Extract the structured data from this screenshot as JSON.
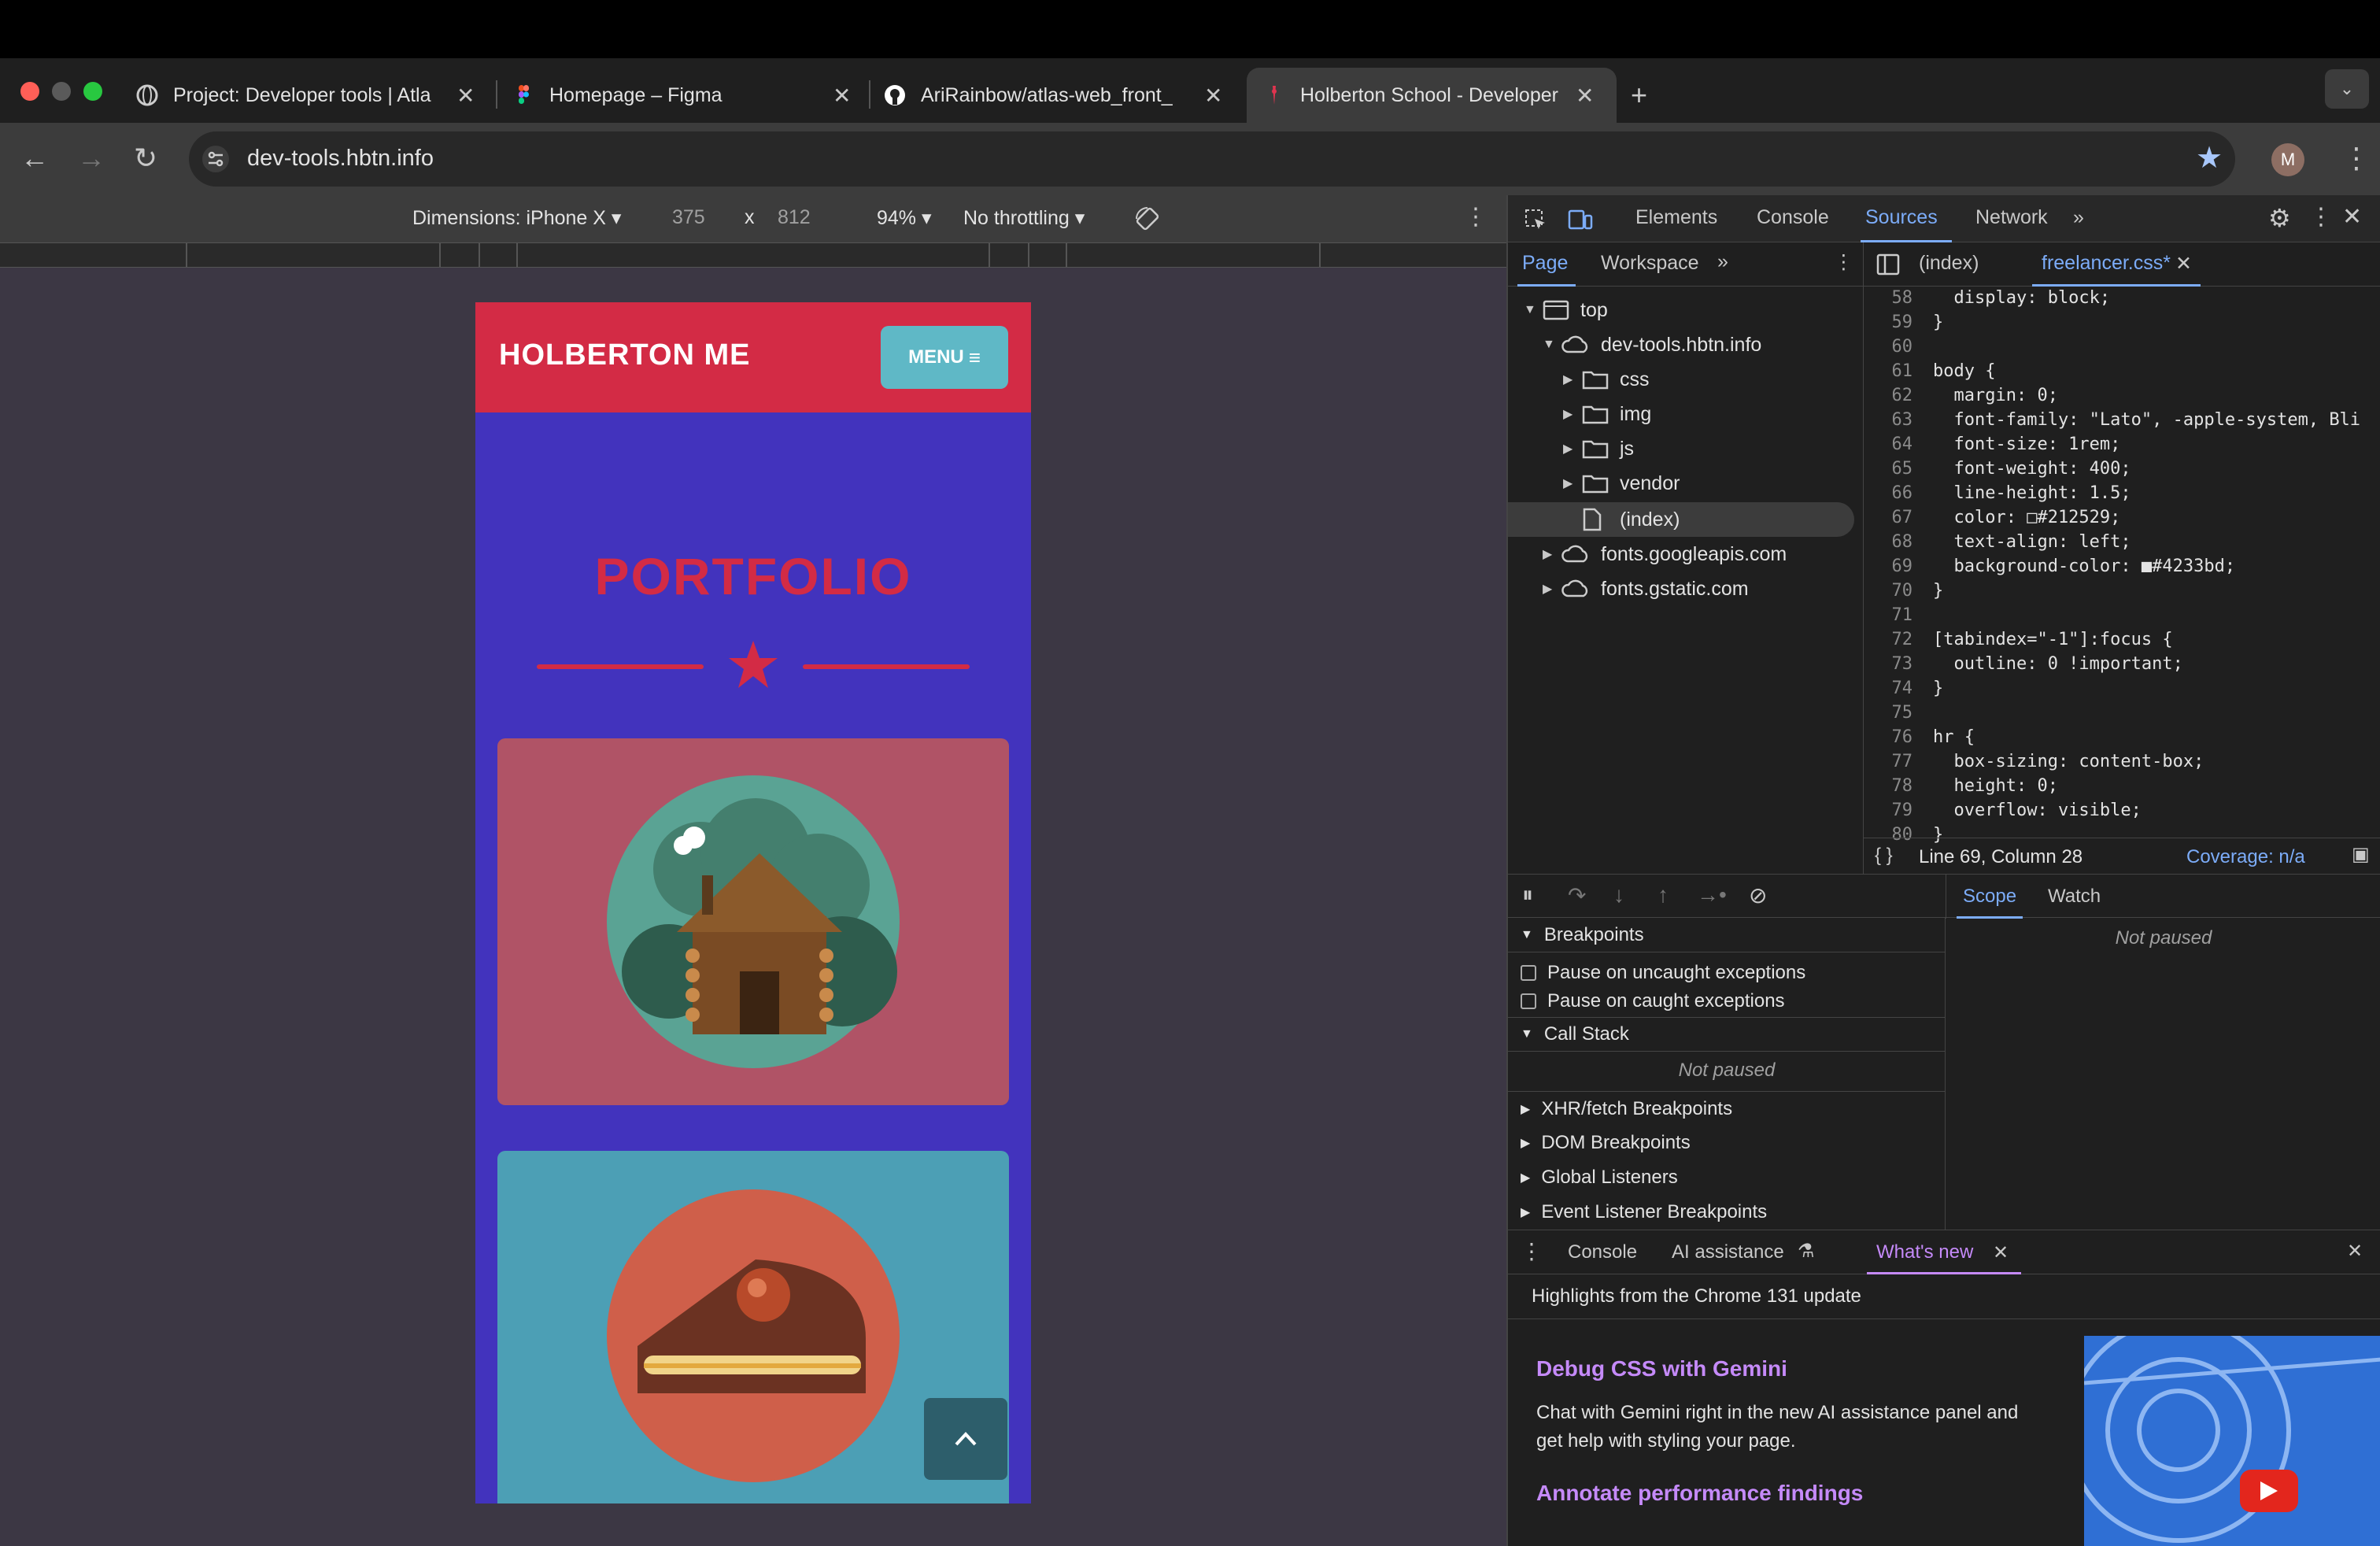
{
  "browser": {
    "tabs": [
      {
        "title": "Project: Developer tools | Atla",
        "icon": "globe-icon"
      },
      {
        "title": "Homepage – Figma",
        "icon": "figma-icon"
      },
      {
        "title": "AriRainbow/atlas-web_front_",
        "icon": "github-icon"
      },
      {
        "title": "Holberton School - Developer",
        "icon": "holberton-icon",
        "active": true
      }
    ],
    "url": "dev-tools.hbtn.info",
    "profile_initial": "M"
  },
  "device_toolbar": {
    "dimensions_label": "Dimensions: iPhone X",
    "width": "375",
    "times": "x",
    "height": "812",
    "zoom": "94%",
    "throttling": "No throttling"
  },
  "mobile_page": {
    "brand": "HOLBERTON ME",
    "menu_label": "MENU",
    "heading": "PORTFOLIO",
    "colors": {
      "nav": "#d32b45",
      "bg": "#4233bd",
      "menu": "#5fb8c6",
      "card1": "#b05366",
      "card2": "#4c9fb5"
    }
  },
  "devtools": {
    "panels": [
      "Elements",
      "Console",
      "Sources",
      "Network"
    ],
    "active_panel": "Sources",
    "navigator": {
      "tabs": [
        "Page",
        "Workspace"
      ],
      "tree": [
        {
          "label": "top",
          "type": "frame"
        },
        {
          "label": "dev-tools.hbtn.info",
          "type": "cloud"
        },
        {
          "label": "css",
          "type": "folder"
        },
        {
          "label": "img",
          "type": "folder"
        },
        {
          "label": "js",
          "type": "folder"
        },
        {
          "label": "vendor",
          "type": "folder"
        },
        {
          "label": "(index)",
          "type": "file"
        },
        {
          "label": "fonts.googleapis.com",
          "type": "cloud"
        },
        {
          "label": "fonts.gstatic.com",
          "type": "cloud"
        }
      ]
    },
    "editor": {
      "tabs": [
        "(index)",
        "freelancer.css*"
      ],
      "lines": [
        {
          "n": "58",
          "text": "  display: block;"
        },
        {
          "n": "59",
          "text": "}"
        },
        {
          "n": "60",
          "text": ""
        },
        {
          "n": "61",
          "text": "body {"
        },
        {
          "n": "62",
          "text": "  margin: 0;"
        },
        {
          "n": "63",
          "text": "  font-family: \"Lato\", -apple-system, Bli"
        },
        {
          "n": "64",
          "text": "  font-size: 1rem;"
        },
        {
          "n": "65",
          "text": "  font-weight: 400;"
        },
        {
          "n": "66",
          "text": "  line-height: 1.5;"
        },
        {
          "n": "67",
          "text": "  color: □#212529;"
        },
        {
          "n": "68",
          "text": "  text-align: left;"
        },
        {
          "n": "69",
          "text": "  background-color: ■#4233bd;"
        },
        {
          "n": "70",
          "text": "}"
        },
        {
          "n": "71",
          "text": ""
        },
        {
          "n": "72",
          "text": "[tabindex=\"-1\"]:focus {"
        },
        {
          "n": "73",
          "text": "  outline: 0 !important;"
        },
        {
          "n": "74",
          "text": "}"
        },
        {
          "n": "75",
          "text": ""
        },
        {
          "n": "76",
          "text": "hr {"
        },
        {
          "n": "77",
          "text": "  box-sizing: content-box;"
        },
        {
          "n": "78",
          "text": "  height: 0;"
        },
        {
          "n": "79",
          "text": "  overflow: visible;"
        },
        {
          "n": "80",
          "text": "}"
        }
      ],
      "status_position": "Line 69, Column 28",
      "status_coverage": "Coverage: n/a"
    },
    "debugger": {
      "breakpoints_title": "Breakpoints",
      "pause_uncaught": "Pause on uncaught exceptions",
      "pause_caught": "Pause on caught exceptions",
      "call_stack_title": "Call Stack",
      "not_paused": "Not paused",
      "sections": [
        "XHR/fetch Breakpoints",
        "DOM Breakpoints",
        "Global Listeners",
        "Event Listener Breakpoints"
      ],
      "scope_tabs": [
        "Scope",
        "Watch"
      ],
      "scope_not_paused": "Not paused"
    },
    "drawer": {
      "tabs": [
        "Console",
        "AI assistance",
        "What's new"
      ],
      "highlight": "Highlights from the Chrome 131 update",
      "headline1": "Debug CSS with Gemini",
      "body1": "Chat with Gemini right in the new AI assistance panel and get help with styling your page.",
      "headline2": "Annotate performance findings"
    }
  }
}
